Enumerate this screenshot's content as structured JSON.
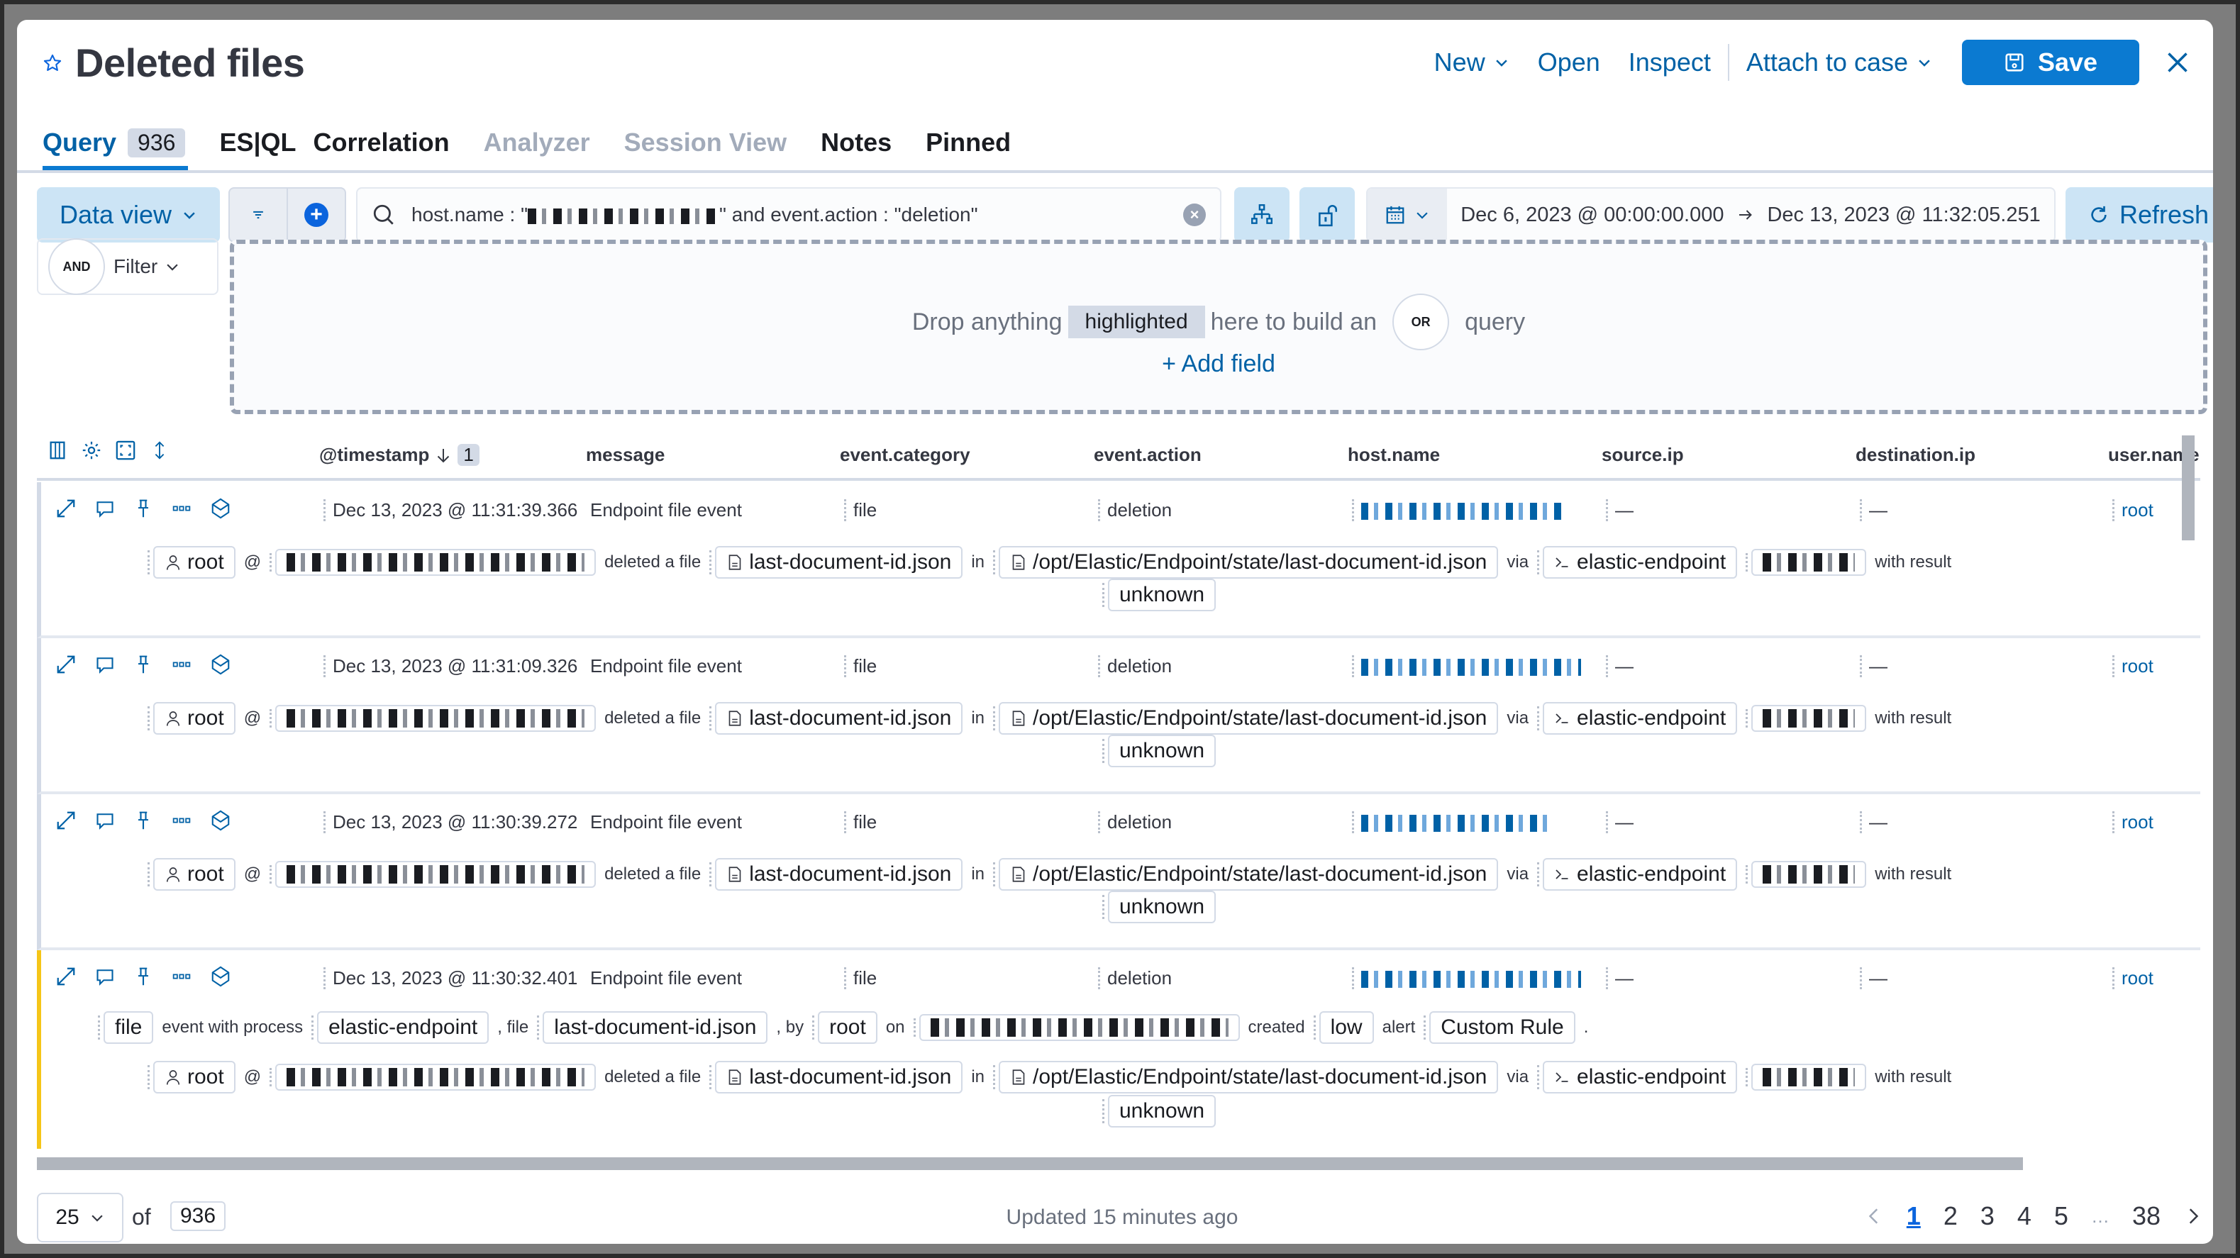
{
  "header": {
    "title": "Deleted files",
    "favorite_icon": "star-icon",
    "actions": {
      "new": "New",
      "open": "Open",
      "inspect": "Inspect",
      "attach_to_case": "Attach to case",
      "save": "Save"
    }
  },
  "tabs": [
    {
      "label": "Query",
      "badge": "936",
      "state": "active"
    },
    {
      "label": "ES|QL",
      "state": "normal"
    },
    {
      "label": "Correlation",
      "state": "normal"
    },
    {
      "label": "Analyzer",
      "state": "disabled"
    },
    {
      "label": "Session View",
      "state": "disabled"
    },
    {
      "label": "Notes",
      "state": "normal"
    },
    {
      "label": "Pinned",
      "state": "normal"
    }
  ],
  "query_bar": {
    "data_view_label": "Data view",
    "query_prefix": "host.name : \"",
    "query_suffix": "\" and event.action : \"deletion\"",
    "date_start": "Dec 6, 2023 @ 00:00:00.000",
    "date_end": "Dec 13, 2023 @ 11:32:05.251",
    "refresh_label": "Refresh"
  },
  "filter": {
    "and_label": "AND",
    "filter_label": "Filter"
  },
  "dropzone": {
    "text_before": "Drop anything",
    "highlight": "highlighted",
    "text_middle": "here to build an",
    "or_label": "OR",
    "text_after": "query",
    "add_field": "+ Add field"
  },
  "grid": {
    "columns": [
      "@timestamp",
      "message",
      "event.category",
      "event.action",
      "host.name",
      "source.ip",
      "destination.ip",
      "user.name"
    ],
    "sort_count": "1",
    "rows": [
      {
        "timestamp": "Dec 13, 2023 @ 11:31:39.366",
        "message": "Endpoint file event",
        "category": "file",
        "action": "deletion",
        "source_ip": "—",
        "destination_ip": "—",
        "user": "root",
        "is_alert": false
      },
      {
        "timestamp": "Dec 13, 2023 @ 11:31:09.326",
        "message": "Endpoint file event",
        "category": "file",
        "action": "deletion",
        "source_ip": "—",
        "destination_ip": "—",
        "user": "root",
        "is_alert": false
      },
      {
        "timestamp": "Dec 13, 2023 @ 11:30:39.272",
        "message": "Endpoint file event",
        "category": "file",
        "action": "deletion",
        "source_ip": "—",
        "destination_ip": "—",
        "user": "root",
        "is_alert": false
      },
      {
        "timestamp": "Dec 13, 2023 @ 11:30:32.401",
        "message": "Endpoint file event",
        "category": "file",
        "action": "deletion",
        "source_ip": "—",
        "destination_ip": "—",
        "user": "root",
        "is_alert": true
      }
    ],
    "renderer": {
      "user": "root",
      "at": "@",
      "deleted_a_file": "deleted a file",
      "file_name": "last-document-id.json",
      "in": "in",
      "file_path": "/opt/Elastic/Endpoint/state/last-document-id.json",
      "via": "via",
      "process": "elastic-endpoint",
      "with_result": "with result",
      "result": "unknown"
    },
    "alert_renderer": {
      "category": "file",
      "event_with_process": "event with process",
      "process": "elastic-endpoint",
      "comma_file": ", file",
      "file_name": "last-document-id.json",
      "comma_by": ", by",
      "user": "root",
      "on": "on",
      "created": "created",
      "severity": "low",
      "alert": "alert",
      "rule": "Custom Rule",
      "period": "."
    }
  },
  "footer": {
    "per_page": "25",
    "of": "of",
    "total": "936",
    "updated": "Updated 15 minutes ago",
    "pages": [
      "1",
      "2",
      "3",
      "4",
      "5",
      "…",
      "38"
    ],
    "current_page": "1"
  }
}
